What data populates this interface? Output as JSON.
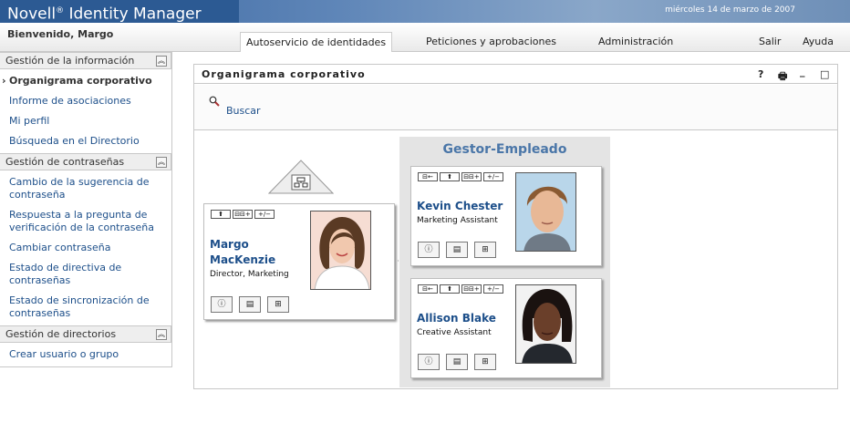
{
  "header": {
    "brand_novell": "Novell",
    "brand_rest": "Identity Manager",
    "date": "miércoles 14 de marzo de 2007"
  },
  "nav": {
    "welcome": "Bienvenido, Margo",
    "tabs": [
      {
        "label": "Autoservicio de identidades"
      },
      {
        "label": "Peticiones y aprobaciones"
      },
      {
        "label": "Administración"
      }
    ],
    "links": {
      "exit": "Salir",
      "help": "Ayuda"
    }
  },
  "sidebar": {
    "sections": [
      {
        "title": "Gestión de la información",
        "items": [
          {
            "label": "Organigrama corporativo"
          },
          {
            "label": "Informe de asociaciones"
          },
          {
            "label": "Mi perfil"
          },
          {
            "label": "Búsqueda en el Directorio"
          }
        ]
      },
      {
        "title": "Gestión de contraseñas",
        "items": [
          {
            "label": "Cambio de la sugerencia de contraseña"
          },
          {
            "label": "Respuesta a la pregunta de verificación de la contraseña"
          },
          {
            "label": "Cambiar contraseña"
          },
          {
            "label": "Estado de directiva de contraseñas"
          },
          {
            "label": "Estado de sincronización de contraseñas"
          }
        ]
      },
      {
        "title": "Gestión de directorios",
        "items": [
          {
            "label": "Crear usuario o grupo"
          }
        ]
      }
    ]
  },
  "portlet": {
    "title": "Organigrama corporativo",
    "controls": {
      "help": "?",
      "print": "🖶",
      "minimize": "_",
      "maximize": "□"
    },
    "search_label": "Buscar"
  },
  "orgchart": {
    "group_title": "Gestor-Empleado",
    "manager": {
      "name_line1": "Margo",
      "name_line2": "MacKenzie",
      "title": "Director, Marketing"
    },
    "employees": [
      {
        "name": "Kevin Chester",
        "title": "Marketing Assistant"
      },
      {
        "name": "Allison Blake",
        "title": "Creative Assistant"
      }
    ],
    "mini_buttons": {
      "left": "⊟←",
      "up": "⬆",
      "tree": "⊟⊟+",
      "plusminus": "+/−"
    }
  },
  "colors": {
    "link": "#1d4f8a",
    "header_blue": "#2c5a93",
    "group_bg": "#e4e4e4"
  }
}
